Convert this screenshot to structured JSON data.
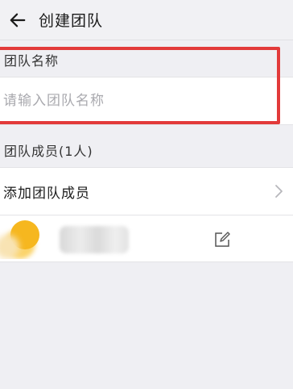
{
  "header": {
    "title": "创建团队",
    "back_icon": "arrow-left-icon"
  },
  "team_name_section": {
    "label": "团队名称",
    "input_placeholder": "请输入团队名称",
    "input_value": "",
    "highlight_color": "#e23a3a"
  },
  "members_section": {
    "label": "团队成员(1人)",
    "add_member_label": "添加团队成员",
    "add_member_icon": "chevron-right-icon",
    "members": [
      {
        "name": "",
        "avatar_icon": "avatar",
        "edit_icon": "edit-icon"
      }
    ]
  }
}
